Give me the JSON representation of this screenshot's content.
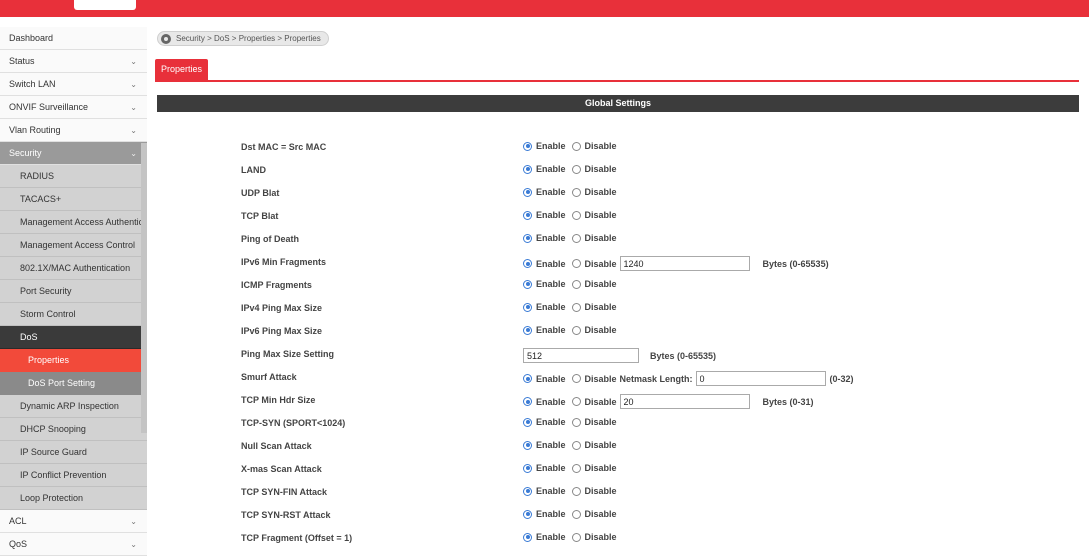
{
  "sidebar": {
    "items": [
      {
        "label": "Dashboard",
        "chevron": false
      },
      {
        "label": "Status",
        "chevron": true
      },
      {
        "label": "Switch LAN",
        "chevron": true
      },
      {
        "label": "ONVIF Surveillance",
        "chevron": true
      },
      {
        "label": "Vlan Routing",
        "chevron": true
      }
    ],
    "security": {
      "label": "Security"
    },
    "security_items": [
      "RADIUS",
      "TACACS+",
      "Management Access Authentication",
      "Management Access Control",
      "802.1X/MAC Authentication",
      "Port Security",
      "Storm Control"
    ],
    "dos": {
      "label": "DoS",
      "children": [
        {
          "label": "Properties",
          "active": true
        },
        {
          "label": "DoS Port Setting",
          "active": false
        }
      ]
    },
    "security_items_after": [
      "Dynamic ARP Inspection",
      "DHCP Snooping",
      "IP Source Guard",
      "IP Conflict Prevention",
      "Loop Protection"
    ],
    "bottom_items": [
      {
        "label": "ACL"
      },
      {
        "label": "QoS"
      }
    ],
    "chevron_glyph": "⌄"
  },
  "breadcrumb": {
    "text": "Security > DoS > Properties > Properties"
  },
  "tab": {
    "label": "Properties"
  },
  "global_settings": {
    "title": "Global Settings"
  },
  "radio_labels": {
    "enable": "Enable",
    "disable": "Disable"
  },
  "settings": [
    {
      "label": "Dst MAC = Src MAC",
      "type": "radio",
      "value": "Enable"
    },
    {
      "label": "LAND",
      "type": "radio",
      "value": "Enable"
    },
    {
      "label": "UDP Blat",
      "type": "radio",
      "value": "Enable"
    },
    {
      "label": "TCP Blat",
      "type": "radio",
      "value": "Enable"
    },
    {
      "label": "Ping of Death",
      "type": "radio",
      "value": "Enable"
    },
    {
      "label": "IPv6 Min Fragments",
      "type": "radio-input",
      "value": "Enable",
      "input_value": "1240",
      "extra": "",
      "unit": "Bytes (0-65535)"
    },
    {
      "label": "ICMP Fragments",
      "type": "radio",
      "value": "Enable"
    },
    {
      "label": "IPv4 Ping Max Size",
      "type": "radio",
      "value": "Enable"
    },
    {
      "label": "IPv6 Ping Max Size",
      "type": "radio",
      "value": "Enable"
    },
    {
      "label": "Ping Max Size Setting",
      "type": "input",
      "input_value": "512",
      "unit": "Bytes (0-65535)"
    },
    {
      "label": "Smurf Attack",
      "type": "radio-input",
      "value": "Enable",
      "input_value": "0",
      "extra": "Netmask Length:",
      "unit": "(0-32)"
    },
    {
      "label": "TCP Min Hdr Size",
      "type": "radio-input",
      "value": "Enable",
      "input_value": "20",
      "extra": "",
      "unit": "Bytes (0-31)"
    },
    {
      "label": "TCP-SYN (SPORT<1024)",
      "type": "radio",
      "value": "Enable"
    },
    {
      "label": "Null Scan Attack",
      "type": "radio",
      "value": "Enable"
    },
    {
      "label": "X-mas Scan Attack",
      "type": "radio",
      "value": "Enable"
    },
    {
      "label": "TCP SYN-FIN Attack",
      "type": "radio",
      "value": "Enable"
    },
    {
      "label": "TCP SYN-RST Attack",
      "type": "radio",
      "value": "Enable"
    },
    {
      "label": "TCP Fragment (Offset = 1)",
      "type": "radio",
      "value": "Enable"
    }
  ],
  "colors": {
    "brand_red": "#e8303a",
    "active_item": "#f24a3a",
    "radio_blue": "#3a7bd5"
  }
}
